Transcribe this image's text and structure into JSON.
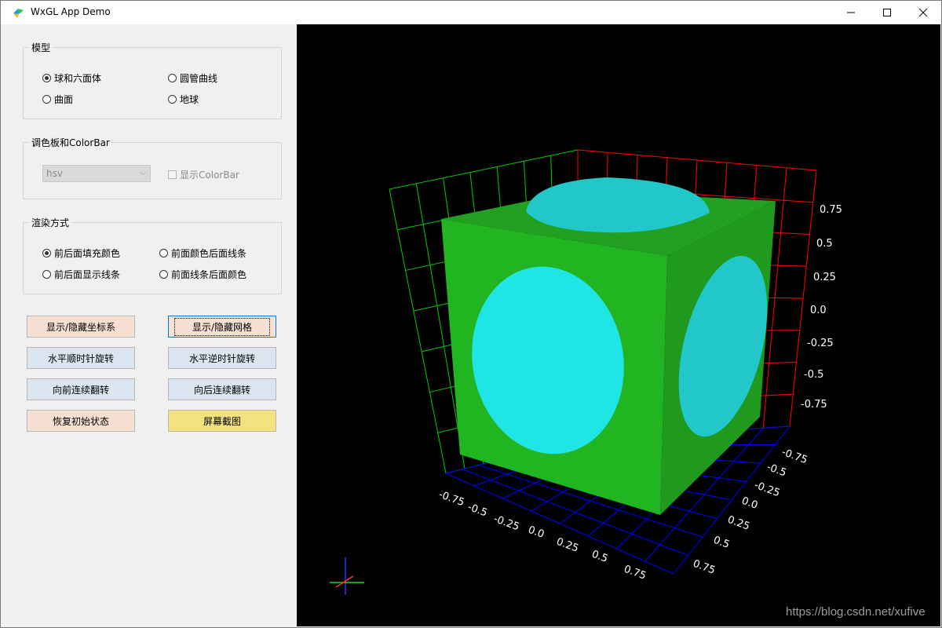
{
  "window": {
    "title": "WxGL App Demo",
    "colors": {
      "titlebar": "#ffffff",
      "panel": "#f0f0f0",
      "viewport": "#000000"
    }
  },
  "groups": {
    "model": {
      "title": "模型",
      "options": [
        "球和六面体",
        "圆管曲线",
        "曲面",
        "地球"
      ],
      "selected": "球和六面体"
    },
    "palette": {
      "title": "调色板和ColorBar",
      "select_value": "hsv",
      "checkbox_label": "显示ColorBar",
      "checkbox_checked": false
    },
    "render": {
      "title": "渲染方式",
      "options": [
        "前后面填充颜色",
        "前面颜色后面线条",
        "前后面显示线条",
        "前面线条后面颜色"
      ],
      "selected": "前后面填充颜色"
    }
  },
  "buttons": {
    "toggle_axes": "显示/隐藏坐标系",
    "toggle_grid": "显示/隐藏网格",
    "rotate_cw": "水平顺时针旋转",
    "rotate_ccw": "水平逆时针旋转",
    "flip_forward": "向前连续翻转",
    "flip_backward": "向后连续翻转",
    "reset": "恢复初始状态",
    "screenshot": "屏幕截图"
  },
  "axes": {
    "z_ticks": [
      "0.75",
      "0.5",
      "0.25",
      "0.0",
      "-0.25",
      "-0.5",
      "-0.75"
    ],
    "x_ticks": [
      "-0.75",
      "-0.5",
      "-0.25",
      "0.0",
      "0.25",
      "0.5",
      "0.75"
    ],
    "y_ticks": [
      "-0.75",
      "-0.5",
      "-0.25",
      "0.0",
      "0.25",
      "0.5",
      "0.75"
    ],
    "colors": {
      "x_grid": "#0000ff",
      "y_grid": "#00cc00",
      "z_grid": "#ff0000"
    }
  },
  "scene": {
    "cube_color": "#22b522",
    "sphere_color": "#1fe5e5"
  },
  "watermark": "https://blog.csdn.net/xufive"
}
